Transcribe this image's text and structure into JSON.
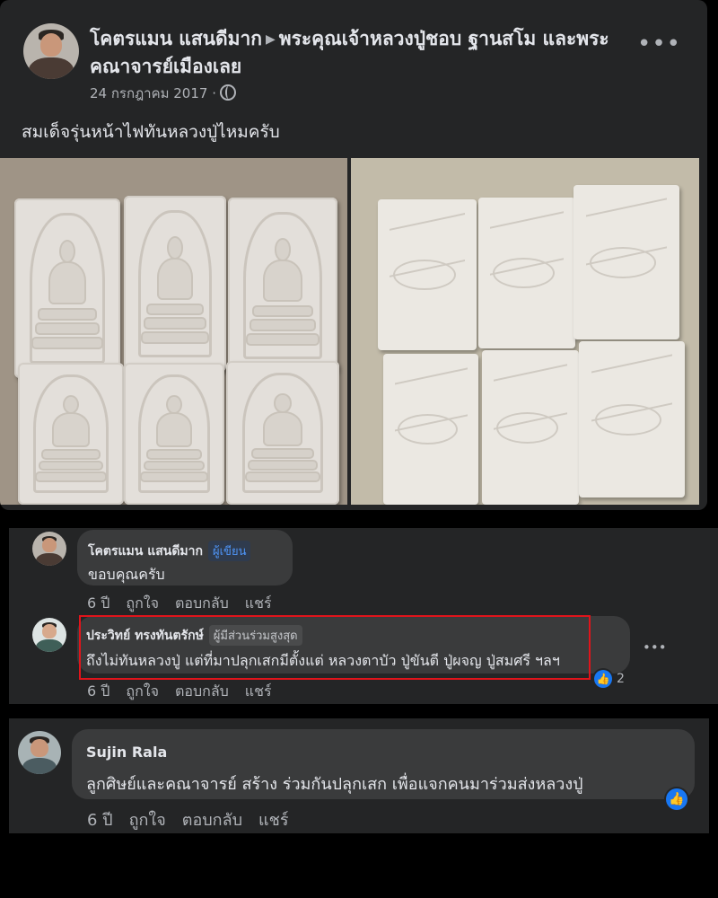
{
  "post": {
    "author": "โคตรแมน แสนดีมาก",
    "arrow": "▶",
    "group": "พระคุณเจ้าหลวงปู่ชอบ ฐานสโม และพระคณาจารย์เมืองเลย",
    "date": "24 กรกฎาคม 2017 ·",
    "more": "•••",
    "text": "สมเด็จรุ่นหน้าไฟทันหลวงปู่ไหมครับ"
  },
  "comments": [
    {
      "name": "โคตรแมน แสนดีมาก",
      "badge": "ผู้เขียน",
      "text": "ขอบคุณครับ",
      "age": "6 ปี",
      "like": "ถูกใจ",
      "reply": "ตอบกลับ",
      "share": "แชร์"
    },
    {
      "name": "ประวิทย์ ทรงทันตรักษ์",
      "badge": "ผู้มีส่วนร่วมสูงสุด",
      "text": "ถึงไม่ทันหลวงปู่ แต่ที่มาปลุกเสกมีตั้งแต่ หลวงตาบัว ปู่ขันตี ปู่ผจญ ปู่สมศรี ฯลฯ",
      "age": "6 ปี",
      "like": "ถูกใจ",
      "reply": "ตอบกลับ",
      "share": "แชร์",
      "reactions": "2",
      "more": "•••"
    },
    {
      "name": "Sujin Rala",
      "text": "ลูกศิษย์และคณาจารย์ สร้าง ร่วมกันปลุกเสก เพื่อแจกคนมาร่วมส่งหลวงปู่",
      "age": "6 ปี",
      "like": "ถูกใจ",
      "reply": "ตอบกลับ",
      "share": "แชร์"
    }
  ],
  "icons": {
    "like": "thumbs-up-icon",
    "globe": "globe-icon",
    "more": "more-options-icon"
  },
  "colors": {
    "card_bg": "#242526",
    "bubble_bg": "#3a3b3c",
    "like_blue": "#1877f2",
    "highlight_red": "#e0141b"
  }
}
